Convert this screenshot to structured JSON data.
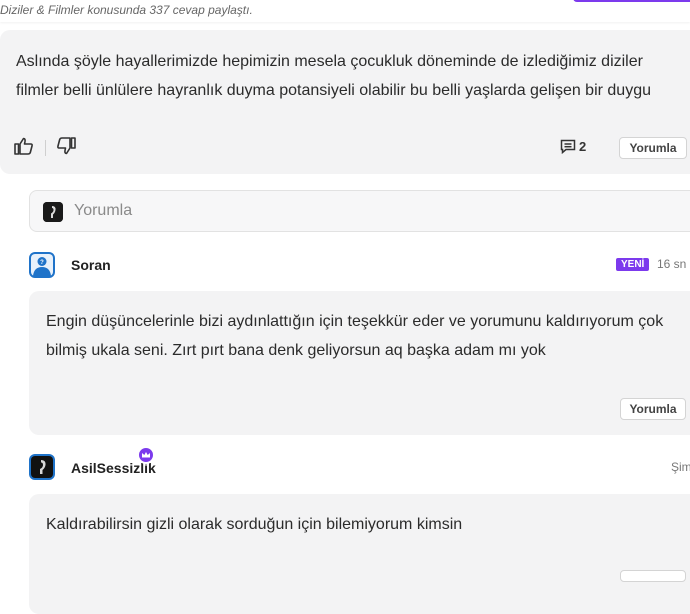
{
  "header": {
    "meta": "Diziler & Filmler konusunda 337 cevap paylaştı."
  },
  "answer": {
    "text": "Aslında şöyle hayallerimizde hepimizin mesela çocukluk döneminde de izlediğimiz diziler filmler belli ünlülere hayranlık duyma potansiyeli olabilir bu belli yaşlarda gelişen bir duygu",
    "comment_count": "2",
    "reply_label": "Yorumla"
  },
  "comment_input": {
    "placeholder": "Yorumla"
  },
  "comments": [
    {
      "author": "Soran",
      "badge": "YENİ",
      "time": "16 sn",
      "text": "Engin düşüncelerinle bizi aydınlattığın için teşekkür eder ve yorumunu kaldırıyorum çok bilmiş ukala seni. Zırt pırt bana denk geliyorsun aq başka adam mı yok",
      "reply_label": "Yorumla"
    },
    {
      "author": "AsilSessizlik",
      "time": "Şim",
      "text": "Kaldırabilirsin gizli olarak sorduğun için bilemiyorum kimsin"
    }
  ],
  "colors": {
    "accent": "#7c3aed",
    "card_bg": "#f3f3f4",
    "avatar_blue": "#1f73c9"
  },
  "icons": [
    "thumbs-up-icon",
    "thumbs-down-icon",
    "comment-icon",
    "crown-icon"
  ]
}
